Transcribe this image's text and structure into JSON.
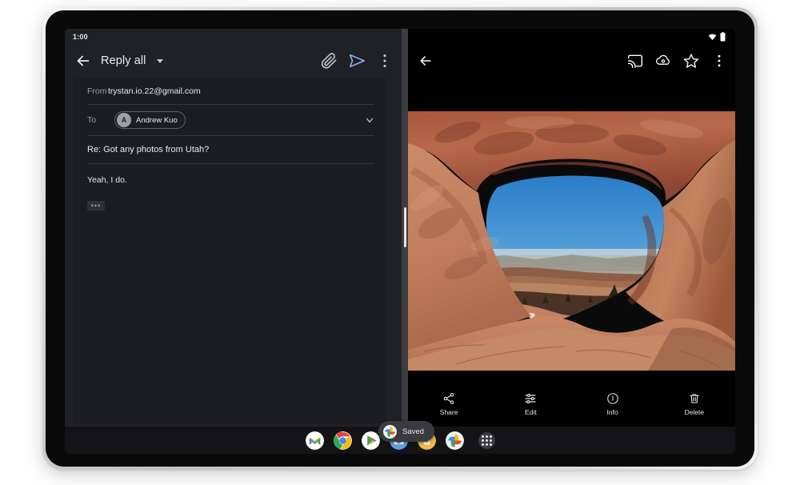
{
  "device": {
    "type": "android-tablet",
    "bezel_color": "#c4c6ca",
    "screen_bg": "#000000"
  },
  "status_bar": {
    "time": "1:00",
    "icons": [
      "wifi-icon",
      "battery-icon"
    ]
  },
  "left_pane": {
    "app": "Gmail",
    "toolbar": {
      "back_icon": "back-arrow-icon",
      "title": "Reply all",
      "dropdown_icon": "chevron-down-icon",
      "attach_label": "Attach file",
      "attach_icon": "paperclip-icon",
      "send_label": "Send",
      "send_icon": "send-icon",
      "send_color": "#8ab4f8",
      "overflow_label": "More options",
      "overflow_icon": "more-vert-icon"
    },
    "compose": {
      "from_label": "From",
      "from_value": "trystan.io.22@gmail.com",
      "to_label": "To",
      "recipient_initial": "A",
      "recipient_name": "Andrew Kuo",
      "expand_icon": "chevron-down-icon",
      "subject": "Re: Got any photos from Utah?",
      "body": "Yeah, I do.",
      "quoted_toggle": "•••"
    }
  },
  "split_divider": {
    "handle": "drag-handle"
  },
  "right_pane": {
    "app": "Google Photos",
    "toolbar": {
      "back_icon": "back-arrow-icon",
      "cast_label": "Cast",
      "cast_icon": "cast-icon",
      "backup_label": "Backup",
      "backup_icon": "cloud-backup-icon",
      "favorite_label": "Favorite",
      "favorite_icon": "star-outline-icon",
      "overflow_label": "More options",
      "overflow_icon": "more-vert-icon"
    },
    "photo": {
      "alt": "Red rock sandstone arch with blue sky and distant valley, Arches National Park Utah",
      "sky_color": "#2b7fc4",
      "rock_color": "#b5694a"
    },
    "actions": [
      {
        "label": "Share",
        "icon": "share-icon"
      },
      {
        "label": "Edit",
        "icon": "tune-sliders-icon"
      },
      {
        "label": "Info",
        "icon": "info-circle-icon"
      },
      {
        "label": "Delete",
        "icon": "trash-icon"
      }
    ]
  },
  "toast": {
    "label": "Saved",
    "icon": "google-photos-icon"
  },
  "dock": {
    "apps": [
      {
        "name": "Gmail",
        "icon": "gmail-icon"
      },
      {
        "name": "Chrome",
        "icon": "chrome-icon"
      },
      {
        "name": "Play Store",
        "icon": "play-store-icon"
      },
      {
        "name": "Camera",
        "icon": "camera-icon"
      },
      {
        "name": "Keep",
        "icon": "keep-icon"
      },
      {
        "name": "Photos",
        "icon": "google-photos-icon"
      }
    ],
    "drawer_label": "All apps",
    "drawer_icon": "apps-grid-icon"
  }
}
